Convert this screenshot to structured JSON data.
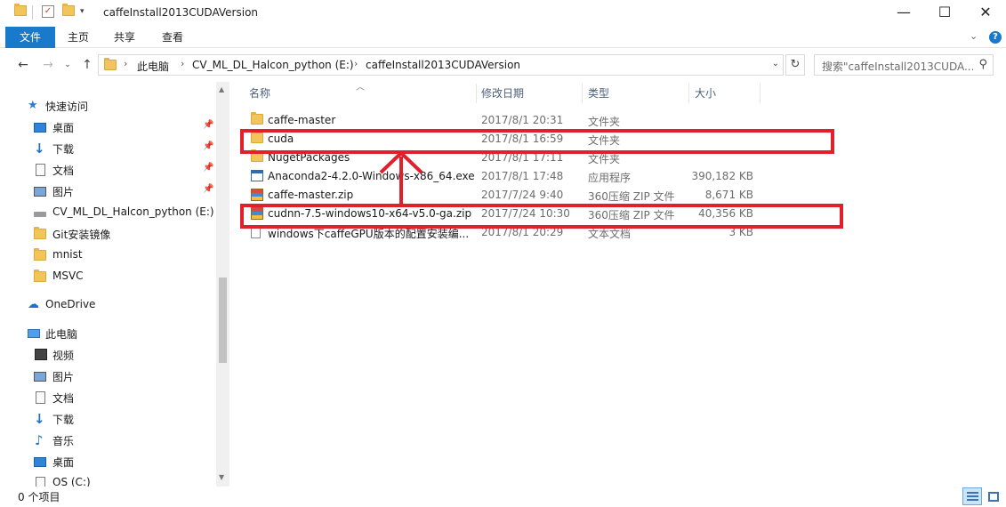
{
  "window": {
    "title": "caffeInstall2013CUDAVersion",
    "minimize_icon": "minimize-icon",
    "maximize_icon": "maximize-icon",
    "close_icon": "close-icon"
  },
  "ribbon": {
    "tabs": [
      {
        "label": "文件",
        "active": true
      },
      {
        "label": "主页",
        "active": false
      },
      {
        "label": "共享",
        "active": false
      },
      {
        "label": "查看",
        "active": false
      }
    ]
  },
  "address": {
    "crumbs": [
      "此电脑",
      "CV_ML_DL_Halcon_python (E:)",
      "caffeInstall2013CUDAVersion"
    ],
    "search_placeholder": "搜索\"caffeInstall2013CUDA...",
    "search_icon": "magnifier-icon"
  },
  "sidebar": {
    "items": [
      {
        "label": "快速访问",
        "icon": "star-icon"
      },
      {
        "label": "桌面",
        "icon": "desktop-icon",
        "pinned": true
      },
      {
        "label": "下载",
        "icon": "download-icon",
        "pinned": true
      },
      {
        "label": "文档",
        "icon": "document-icon",
        "pinned": true
      },
      {
        "label": "图片",
        "icon": "picture-icon",
        "pinned": true
      },
      {
        "label": "CV_ML_DL_Halcon_python (E:)",
        "icon": "drive-icon"
      },
      {
        "label": "Git安装镜像",
        "icon": "folder-icon"
      },
      {
        "label": "mnist",
        "icon": "folder-icon"
      },
      {
        "label": "MSVC",
        "icon": "folder-icon"
      },
      {
        "label": "OneDrive",
        "icon": "cloud-icon"
      },
      {
        "label": "此电脑",
        "icon": "computer-icon"
      },
      {
        "label": "视频",
        "icon": "video-icon"
      },
      {
        "label": "图片",
        "icon": "picture-icon"
      },
      {
        "label": "文档",
        "icon": "document-icon"
      },
      {
        "label": "下载",
        "icon": "download-icon"
      },
      {
        "label": "音乐",
        "icon": "music-icon"
      },
      {
        "label": "桌面",
        "icon": "desktop-icon"
      },
      {
        "label": "OS (C:)",
        "icon": "drive-icon"
      }
    ]
  },
  "filelist": {
    "columns": [
      "名称",
      "修改日期",
      "类型",
      "大小"
    ],
    "rows": [
      {
        "name": "caffe-master",
        "date": "2017/8/1 20:31",
        "type": "文件夹",
        "size": "",
        "icon": "folder-icon"
      },
      {
        "name": "cuda",
        "date": "2017/8/1 16:59",
        "type": "文件夹",
        "size": "",
        "icon": "folder-icon"
      },
      {
        "name": "NugetPackages",
        "date": "2017/8/1 17:11",
        "type": "文件夹",
        "size": "",
        "icon": "folder-icon"
      },
      {
        "name": "Anaconda2-4.2.0-Windows-x86_64.exe",
        "date": "2017/8/1 17:48",
        "type": "应用程序",
        "size": "390,182 KB",
        "icon": "exe-icon"
      },
      {
        "name": "caffe-master.zip",
        "date": "2017/7/24 9:40",
        "type": "360压缩 ZIP 文件",
        "size": "8,671 KB",
        "icon": "zip-icon"
      },
      {
        "name": "cudnn-7.5-windows10-x64-v5.0-ga.zip",
        "date": "2017/7/24 10:30",
        "type": "360压缩 ZIP 文件",
        "size": "40,356 KB",
        "icon": "zip-icon"
      },
      {
        "name": "windows下caffeGPU版本的配置安装编...",
        "date": "2017/8/1 20:29",
        "type": "文本文档",
        "size": "3 KB",
        "icon": "text-file-icon"
      }
    ]
  },
  "status": {
    "text": "0 个项目"
  },
  "annotation_color": "#e0202a"
}
